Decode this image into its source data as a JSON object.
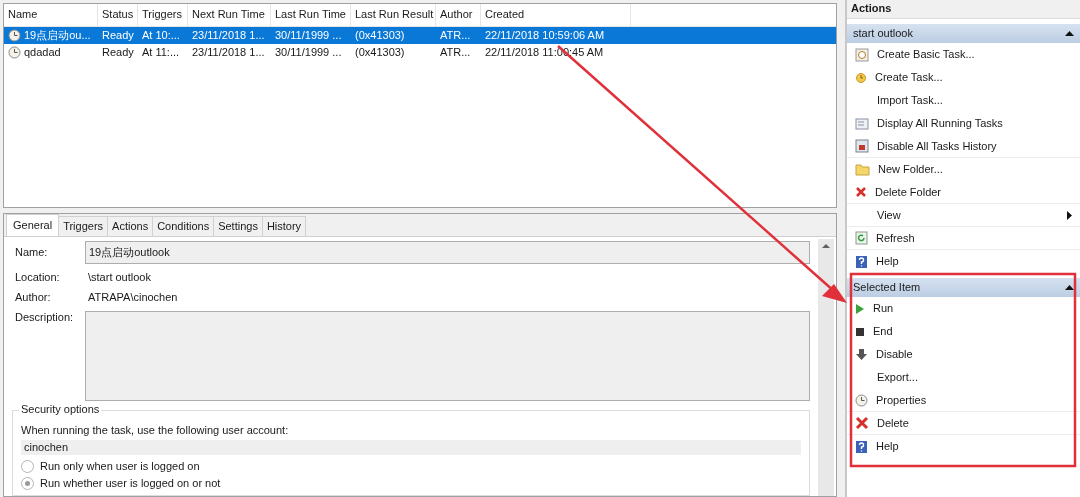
{
  "task_list": {
    "columns": [
      "Name",
      "Status",
      "Triggers",
      "Next Run Time",
      "Last Run Time",
      "Last Run Result",
      "Author",
      "Created"
    ],
    "rows": [
      {
        "selected": true,
        "cells": [
          "19点启动ou...",
          "Ready",
          "At 10:...",
          "23/11/2018 1...",
          "30/11/1999 ...",
          "(0x41303)",
          "ATR...",
          "22/11/2018 10:59:06 AM"
        ]
      },
      {
        "selected": false,
        "cells": [
          "qdadad",
          "Ready",
          "At 11:...",
          "23/11/2018 1...",
          "30/11/1999 ...",
          "(0x41303)",
          "ATR...",
          "22/11/2018 11:00:45 AM"
        ]
      }
    ]
  },
  "detail": {
    "tabs": [
      {
        "label": "General",
        "selected": true
      },
      {
        "label": "Triggers",
        "selected": false
      },
      {
        "label": "Actions",
        "selected": false
      },
      {
        "label": "Conditions",
        "selected": false
      },
      {
        "label": "Settings",
        "selected": false
      },
      {
        "label": "History",
        "selected": false
      }
    ],
    "general": {
      "name_label": "Name:",
      "name_value": "19点启动outlook",
      "location_label": "Location:",
      "location_value": "\\start outlook",
      "author_label": "Author:",
      "author_value": "ATRAPA\\cinochen",
      "description_label": "Description:",
      "security": {
        "title": "Security options",
        "account_prompt": "When running the task, use the following user account:",
        "account_value": "cinochen",
        "options": [
          {
            "label": "Run only when user is logged on",
            "selected": false
          },
          {
            "label": "Run whether user is logged on or not",
            "selected": true
          }
        ]
      }
    }
  },
  "actions": {
    "title": "Actions",
    "groups": [
      {
        "title": "start outlook",
        "expanded": true,
        "items": [
          {
            "label": "Create Basic Task...",
            "submenu": false
          },
          {
            "label": "Create Task...",
            "submenu": false
          },
          {
            "label": "Import Task...",
            "submenu": false
          },
          {
            "label": "Display All Running Tasks",
            "submenu": false
          },
          {
            "label": "Disable All Tasks History",
            "submenu": false
          },
          {
            "label": "New Folder...",
            "submenu": false
          },
          {
            "label": "Delete Folder",
            "submenu": false
          },
          {
            "label": "View",
            "submenu": true
          },
          {
            "label": "Refresh",
            "submenu": false
          },
          {
            "label": "Help",
            "submenu": false
          }
        ]
      },
      {
        "title": "Selected Item",
        "expanded": true,
        "items": [
          {
            "label": "Run",
            "submenu": false
          },
          {
            "label": "End",
            "submenu": false
          },
          {
            "label": "Disable",
            "submenu": false
          },
          {
            "label": "Export...",
            "submenu": false
          },
          {
            "label": "Properties",
            "submenu": false
          },
          {
            "label": "Delete",
            "submenu": false
          },
          {
            "label": "Help",
            "submenu": false
          }
        ]
      }
    ]
  }
}
